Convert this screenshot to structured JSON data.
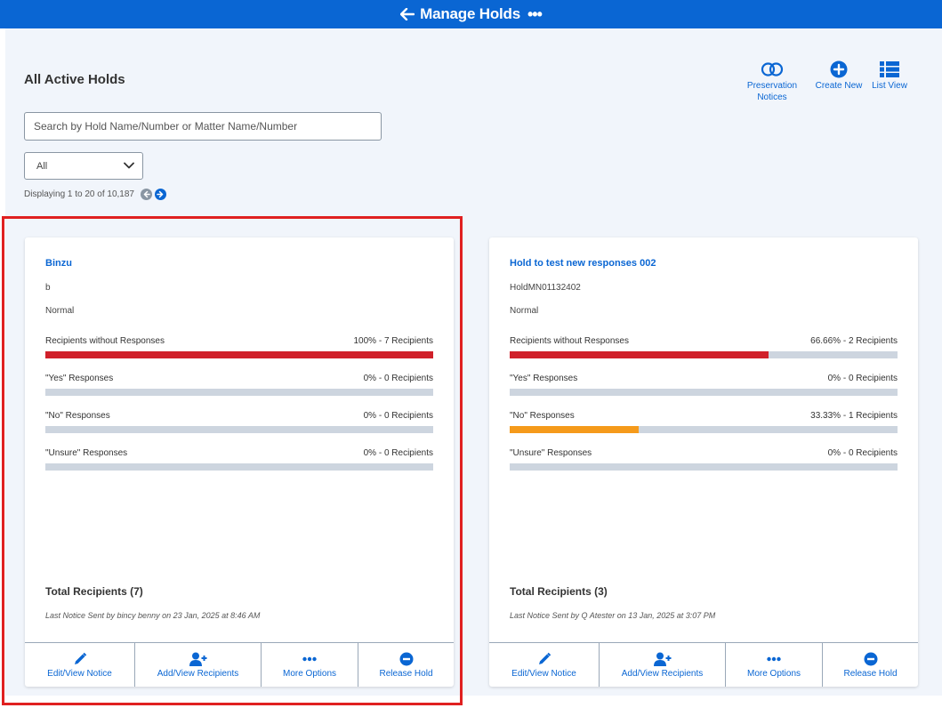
{
  "header": {
    "title": "Manage Holds"
  },
  "page": {
    "title": "All Active Holds"
  },
  "toolbar": {
    "preservation_label": "Preservation Notices",
    "create_label": "Create New",
    "list_label": "List View"
  },
  "search": {
    "placeholder": "Search by Hold Name/Number or Matter Name/Number"
  },
  "filter": {
    "selected": "All"
  },
  "pagination": {
    "text": "Displaying 1 to 20 of 10,187"
  },
  "colors": {
    "brand": "#0a66d3",
    "no_response": "#d0202a",
    "no": "#f59a1b",
    "track": "#cdd5df"
  },
  "cards": [
    {
      "name": "Binzu",
      "number": "b",
      "priority": "Normal",
      "metrics": [
        {
          "label": "Recipients without Responses",
          "value": "100% - 7 Recipients",
          "fraction": 1.0,
          "color": "#d0202a"
        },
        {
          "label": "\"Yes\" Responses",
          "value": "0% - 0 Recipients",
          "fraction": 0,
          "color": "#cdd5df"
        },
        {
          "label": "\"No\" Responses",
          "value": "0% - 0 Recipients",
          "fraction": 0,
          "color": "#f59a1b"
        },
        {
          "label": "\"Unsure\" Responses",
          "value": "0% - 0 Recipients",
          "fraction": 0,
          "color": "#cdd5df"
        }
      ],
      "total": "Total Recipients (7)",
      "last_notice": "Last Notice Sent by bincy benny on 23 Jan, 2025 at 8:46 AM",
      "actions": {
        "edit": "Edit/View Notice",
        "add": "Add/View Recipients",
        "more": "More Options",
        "release": "Release Hold"
      }
    },
    {
      "name": "Hold to test new responses 002",
      "number": "HoldMN01132402",
      "priority": "Normal",
      "metrics": [
        {
          "label": "Recipients without Responses",
          "value": "66.66% - 2 Recipients",
          "fraction": 0.6666,
          "color": "#d0202a"
        },
        {
          "label": "\"Yes\" Responses",
          "value": "0% - 0 Recipients",
          "fraction": 0,
          "color": "#cdd5df"
        },
        {
          "label": "\"No\" Responses",
          "value": "33.33% - 1 Recipients",
          "fraction": 0.3333,
          "color": "#f59a1b"
        },
        {
          "label": "\"Unsure\" Responses",
          "value": "0% - 0 Recipients",
          "fraction": 0,
          "color": "#cdd5df"
        }
      ],
      "total": "Total Recipients (3)",
      "last_notice": "Last Notice Sent by Q Atester on 13 Jan, 2025 at 3:07 PM",
      "actions": {
        "edit": "Edit/View Notice",
        "add": "Add/View Recipients",
        "more": "More Options",
        "release": "Release Hold"
      }
    }
  ]
}
